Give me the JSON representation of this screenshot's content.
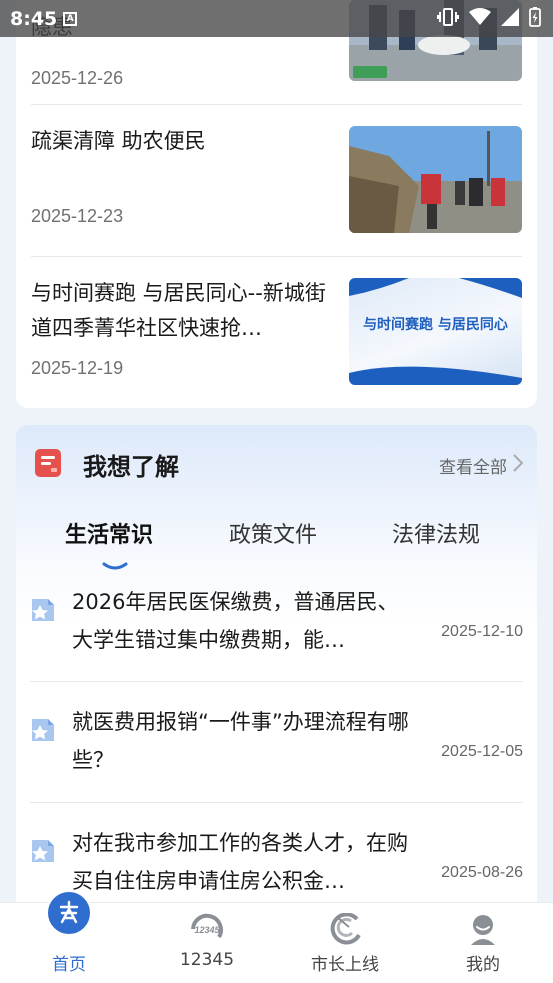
{
  "status_bar": {
    "time": "8:45",
    "notification_glyph": "A"
  },
  "news": {
    "items": [
      {
        "title": "隐患",
        "date": "2025-12-26"
      },
      {
        "title": "疏渠清障  助农便民",
        "date": "2025-12-23"
      },
      {
        "title": "与时间赛跑 与居民同心--新城街道四季菁华社区快速抢…",
        "date": "2025-12-19",
        "thumb_caption": "与时间赛跑 与居民同心"
      }
    ]
  },
  "know_section": {
    "title": "我想了解",
    "view_all": "查看全部",
    "tabs": [
      {
        "label": "生活常识",
        "active": true
      },
      {
        "label": "政策文件",
        "active": false
      },
      {
        "label": "法律法规",
        "active": false
      }
    ],
    "items": [
      {
        "title": "2026年居民医保缴费，普通居民、大学生错过集中缴费期，能…",
        "date": "2025-12-10"
      },
      {
        "title": "就医费用报销“一件事”办理流程有哪些？",
        "date": "2025-12-05"
      },
      {
        "title": "对在我市参加工作的各类人才，在购买自住住房申请住房公积金…",
        "date": "2025-08-26"
      }
    ]
  },
  "tabbar": {
    "items": [
      {
        "label": "首页",
        "icon": "home-icon",
        "active": true
      },
      {
        "label": "12345",
        "icon": "hotline-12345-icon",
        "icon_text": "12345",
        "active": false
      },
      {
        "label": "市长上线",
        "icon": "mayor-online-icon",
        "active": false
      },
      {
        "label": "我的",
        "icon": "profile-icon",
        "active": false
      }
    ]
  },
  "colors": {
    "accent": "#2f6dcf",
    "page_bg": "#eef3fa",
    "doc_red": "#e5524e"
  }
}
